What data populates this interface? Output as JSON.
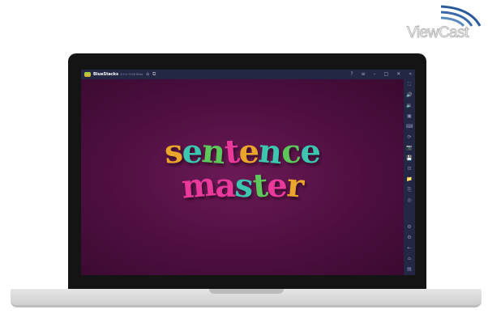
{
  "watermark": {
    "text": "ViewCast"
  },
  "window": {
    "app_title": "BlueStacks",
    "version": "4.0.0.7228 Beta"
  },
  "titlebar_icons": [
    "home-icon",
    "multi-instance-icon",
    "help-icon",
    "menu-icon",
    "minimize-icon",
    "maximize-icon",
    "close-icon",
    "collapse-icon"
  ],
  "sidebar_icons": [
    "fullscreen-icon",
    "volume-up-icon",
    "volume-down-icon",
    "record-icon",
    "keyboard-icon",
    "rotate-icon",
    "camera-icon",
    "save-icon",
    "screenshot-icon",
    "folder-icon",
    "copy-icon",
    "location-icon",
    "settings-icon",
    "settings2-icon",
    "back-icon",
    "home2-icon",
    "recent-icon"
  ],
  "game": {
    "line1": [
      "s",
      "e",
      "n",
      "t",
      "e",
      "n",
      "c",
      "e"
    ],
    "line2": [
      "m",
      "a",
      "s",
      "t",
      "e",
      "r"
    ],
    "colors1": [
      "#e9a52c",
      "#3cc6b0",
      "#5cc85a",
      "#e93a9c",
      "#e9a52c",
      "#3cc6b0",
      "#5cc85a",
      "#3cc6b0"
    ],
    "colors2": [
      "#e93a9c",
      "#e93a9c",
      "#3cc6b0",
      "#5cc85a",
      "#e93a9c",
      "#e9a52c"
    ]
  }
}
